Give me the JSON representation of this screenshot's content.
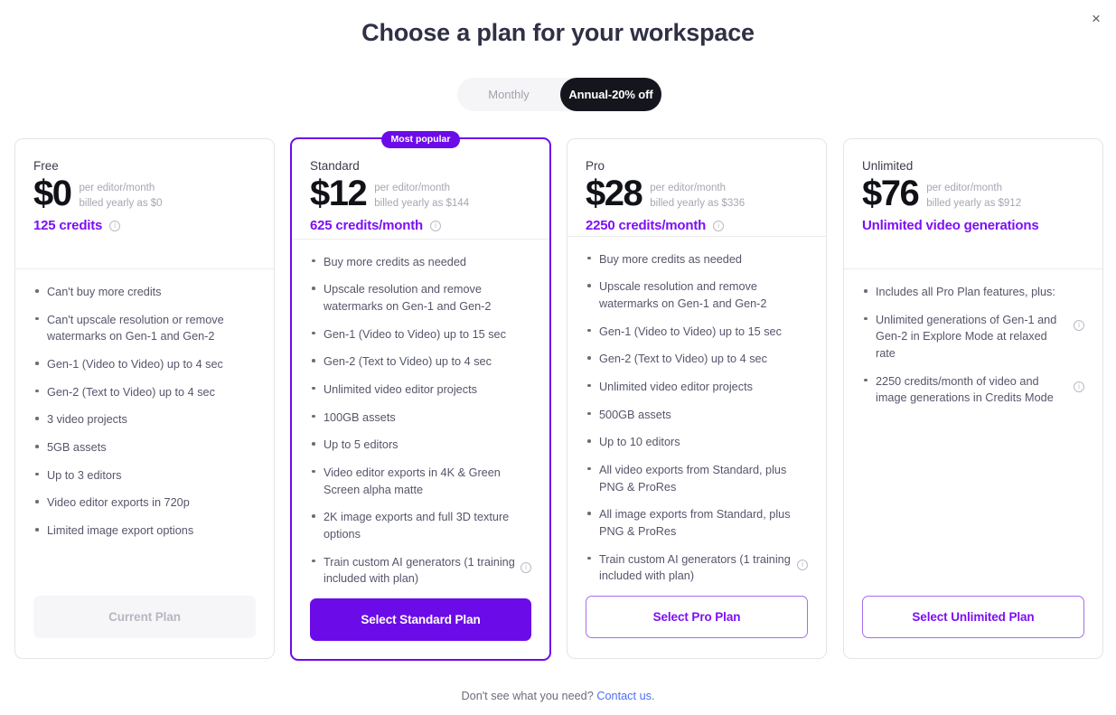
{
  "header": {
    "title": "Choose a plan for your workspace",
    "close_label": "×"
  },
  "billing_toggle": {
    "monthly_label": "Monthly",
    "annual_label": "Annual-20% off",
    "selected": "annual"
  },
  "colors": {
    "accent_purple": "#6b0ce8",
    "credits_purple": "#7d0ff5",
    "link_blue": "#4f6ff2",
    "toggle_dark": "#15161d"
  },
  "info_glyph": "i",
  "plans": [
    {
      "name": "Free",
      "price": "$0",
      "per": "per editor/month",
      "billed": "billed yearly as $0",
      "credits": "125 credits",
      "credits_info": true,
      "features": [
        {
          "text": "Can't buy more credits",
          "info": false
        },
        {
          "text": "Can't upscale resolution or remove watermarks on Gen-1 and Gen-2",
          "info": false
        },
        {
          "text": "Gen-1 (Video to Video) up to 4 sec",
          "info": false
        },
        {
          "text": "Gen-2 (Text to Video) up to 4 sec",
          "info": false
        },
        {
          "text": "3 video projects",
          "info": false
        },
        {
          "text": "5GB assets",
          "info": false
        },
        {
          "text": "Up to 3 editors",
          "info": false
        },
        {
          "text": "Video editor exports in 720p",
          "info": false
        },
        {
          "text": "Limited image export options",
          "info": false
        }
      ],
      "cta_label": "Current Plan",
      "cta_style": "disabled",
      "badge": null
    },
    {
      "name": "Standard",
      "price": "$12",
      "per": "per editor/month",
      "billed": "billed yearly as $144",
      "credits": "625 credits/month",
      "credits_info": true,
      "features": [
        {
          "text": "Buy more credits as needed",
          "info": false
        },
        {
          "text": "Upscale resolution and remove watermarks on Gen-1 and Gen-2",
          "info": false
        },
        {
          "text": "Gen-1 (Video to Video) up to 15 sec",
          "info": false
        },
        {
          "text": "Gen-2 (Text to Video) up to 4 sec",
          "info": false
        },
        {
          "text": "Unlimited video editor projects",
          "info": false
        },
        {
          "text": "100GB assets",
          "info": false
        },
        {
          "text": "Up to 5 editors",
          "info": false
        },
        {
          "text": "Video editor exports in 4K & Green Screen alpha matte",
          "info": false
        },
        {
          "text": "2K image exports and full 3D texture options",
          "info": false
        },
        {
          "text": "Train custom AI generators (1 training included with plan)",
          "info": true
        }
      ],
      "cta_label": "Select Standard Plan",
      "cta_style": "filled",
      "badge": "Most popular"
    },
    {
      "name": "Pro",
      "price": "$28",
      "per": "per editor/month",
      "billed": "billed yearly as $336",
      "credits": "2250 credits/month",
      "credits_info": true,
      "features": [
        {
          "text": "Buy more credits as needed",
          "info": false
        },
        {
          "text": "Upscale resolution and remove watermarks on Gen-1 and Gen-2",
          "info": false
        },
        {
          "text": "Gen-1 (Video to Video) up to 15 sec",
          "info": false
        },
        {
          "text": "Gen-2 (Text to Video) up to 4 sec",
          "info": false
        },
        {
          "text": "Unlimited video editor projects",
          "info": false
        },
        {
          "text": "500GB assets",
          "info": false
        },
        {
          "text": "Up to 10 editors",
          "info": false
        },
        {
          "text": "All video exports from Standard, plus PNG & ProRes",
          "info": false
        },
        {
          "text": "All image exports from Standard, plus PNG & ProRes",
          "info": false
        },
        {
          "text": "Train custom AI generators (1 training included with plan)",
          "info": true
        }
      ],
      "cta_label": "Select Pro Plan",
      "cta_style": "outline",
      "badge": null
    },
    {
      "name": "Unlimited",
      "price": "$76",
      "per": "per editor/month",
      "billed": "billed yearly as $912",
      "credits": "Unlimited video generations",
      "credits_info": false,
      "features": [
        {
          "text": "Includes all Pro Plan features, plus:",
          "info": false
        },
        {
          "text": "Unlimited generations of Gen-1 and Gen-2 in Explore Mode at relaxed rate",
          "info": true
        },
        {
          "text": "2250 credits/month of video and image generations in Credits Mode",
          "info": true
        }
      ],
      "cta_label": "Select Unlimited Plan",
      "cta_style": "outline",
      "badge": null
    }
  ],
  "footer": {
    "text": "Don't see what you need? ",
    "link_label": "Contact us",
    "link_suffix": "."
  }
}
